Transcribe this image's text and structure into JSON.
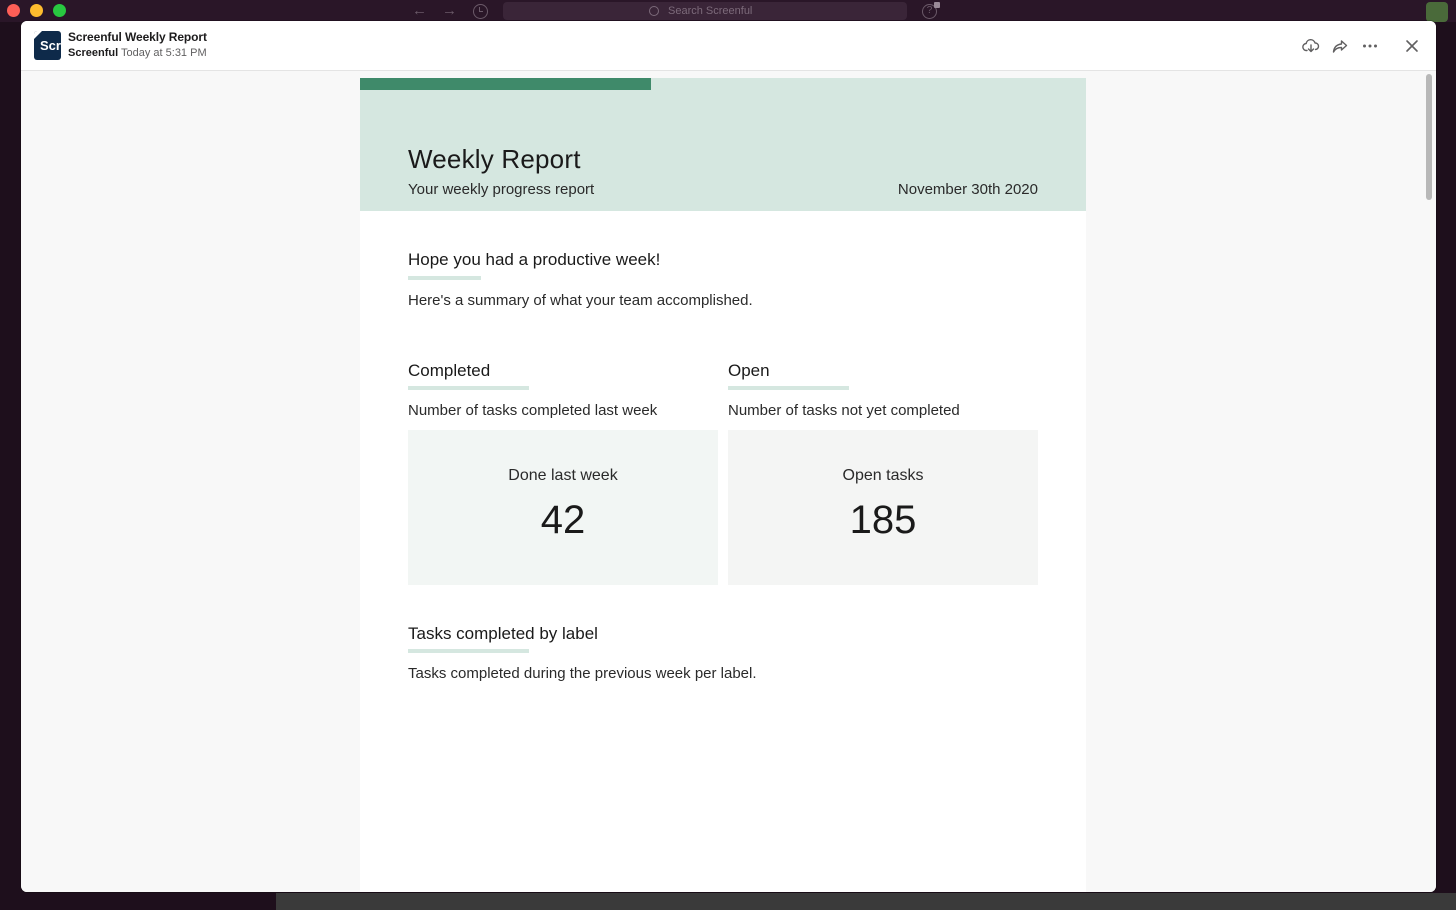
{
  "window": {
    "search_placeholder": "Search Screenful"
  },
  "header": {
    "logo_text": "Scr",
    "title": "Screenful Weekly Report",
    "sender": "Screenful",
    "timestamp": "Today at 5:31 PM",
    "icons": [
      "download-icon",
      "share-icon",
      "more-icon",
      "close-icon"
    ]
  },
  "report": {
    "title": "Weekly Report",
    "subtitle": "Your weekly progress report",
    "date": "November 30th 2020",
    "intro": {
      "heading": "Hope you had a productive week!",
      "text": "Here's a summary of what your team accomplished."
    },
    "completed": {
      "heading": "Completed",
      "description": "Number of tasks completed last week",
      "box_label": "Done last week",
      "value": "42"
    },
    "open": {
      "heading": "Open",
      "description": "Number of tasks not yet completed",
      "box_label": "Open tasks",
      "value": "185"
    },
    "by_label": {
      "heading": "Tasks completed by label",
      "text": "Tasks completed during the previous week per label."
    }
  },
  "colors": {
    "accent": "#3f8a6a",
    "hero_bg": "#d5e7e0",
    "logo_bg": "#0e2a4a"
  }
}
